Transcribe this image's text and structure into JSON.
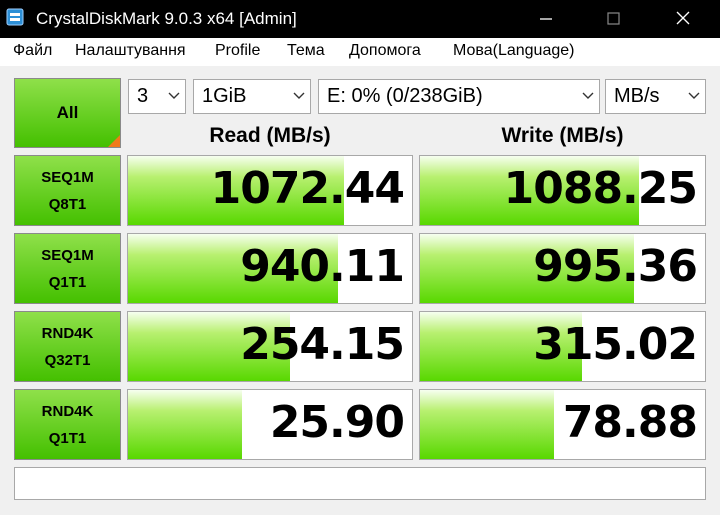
{
  "window": {
    "title": "CrystalDiskMark 9.0.3 x64 [Admin]",
    "app_icon": "crystaldiskmark-icon",
    "controls": [
      "minimize-icon",
      "maximize-icon",
      "close-icon"
    ]
  },
  "menu": {
    "items": [
      "Файл",
      "Налаштування",
      "Profile",
      "Тема",
      "Допомога",
      "Мова(Language)"
    ]
  },
  "controls": {
    "all_label": "All",
    "count": "3",
    "size": "1GiB",
    "drive": "E: 0% (0/238GiB)",
    "unit": "MB/s"
  },
  "headers": {
    "read": "Read (MB/s)",
    "write": "Write (MB/s)"
  },
  "rows": [
    {
      "line1": "SEQ1M",
      "line2": "Q8T1",
      "read": "1072.44",
      "write": "1088.25",
      "read_fill": 0.76,
      "write_fill": 0.77
    },
    {
      "line1": "SEQ1M",
      "line2": "Q1T1",
      "read": "940.11",
      "write": "995.36",
      "read_fill": 0.74,
      "write_fill": 0.75
    },
    {
      "line1": "RND4K",
      "line2": "Q32T1",
      "read": "254.15",
      "write": "315.02",
      "read_fill": 0.57,
      "write_fill": 0.57
    },
    {
      "line1": "RND4K",
      "line2": "Q1T1",
      "read": "25.90",
      "write": "78.88",
      "read_fill": 0.4,
      "write_fill": 0.47
    }
  ],
  "status_text": "",
  "colors": {
    "titlebar": "#000000",
    "button_green": "#44c000",
    "bar_green": "#58d800",
    "accent_orange": "#f07a1a"
  }
}
